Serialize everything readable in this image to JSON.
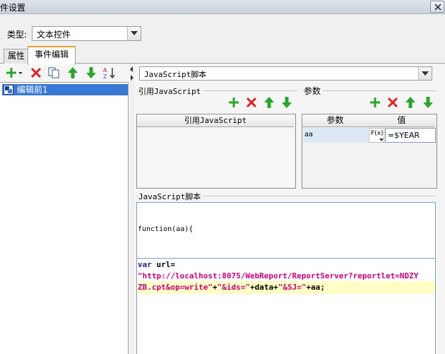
{
  "window": {
    "title": "件设置"
  },
  "type_row": {
    "label": "类型:",
    "value": "文本控件"
  },
  "tabs": [
    {
      "label": "属性"
    },
    {
      "label": "事件编辑"
    }
  ],
  "left_toolbar": {
    "icons": [
      "add-icon",
      "delete-icon",
      "copy-icon",
      "move-up-icon",
      "move-down-icon",
      "sort-icon"
    ]
  },
  "event_list": {
    "items": [
      {
        "label": "编辑前1"
      }
    ]
  },
  "right": {
    "script_type": "JavaScript脚本",
    "ref_group_title": "引用JavaScript",
    "ref_table_header": "引用JavaScript",
    "param_group_title": "参数",
    "param_headers": {
      "name": "参数",
      "value": "值"
    },
    "params": [
      {
        "name": "aa",
        "fx": "F(x)",
        "value": "=$YEAR"
      }
    ],
    "script_group_title": "JavaScript脚本",
    "function_signature": "function(aa){",
    "code": {
      "line1_kw": "var",
      "line1_rest": " url=",
      "line2": "\"http://localhost:8075/WebReport/ReportServer?reportlet=NDZY",
      "line3_str1": "ZB.cpt&op=write\"",
      "line3_plus1": "+",
      "line3_str2": "\"&ids=\"",
      "line3_plus2": "+data+",
      "line3_str3": "\"&SJ=\"",
      "line3_end": "+aa;"
    }
  },
  "colors": {
    "green": "#2aa52a",
    "red": "#e02020",
    "selection": "#3a78d6",
    "code_string": "#c8007a",
    "code_keyword": "#1f1fa8",
    "highlight": "#ffffc6"
  }
}
